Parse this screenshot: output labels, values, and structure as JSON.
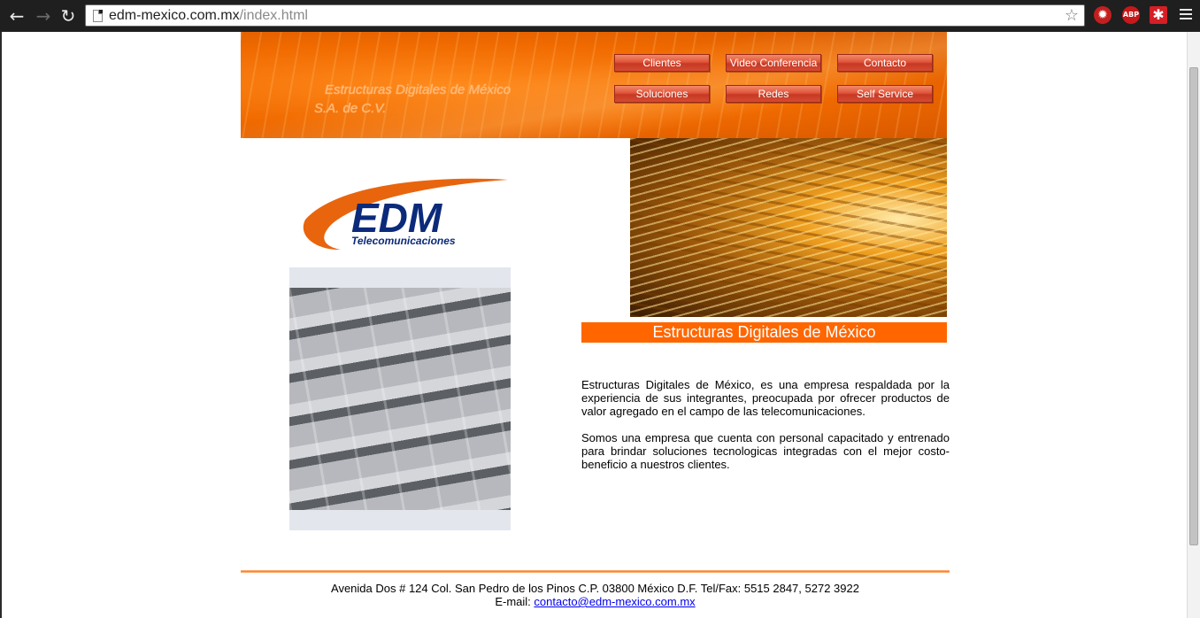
{
  "browser": {
    "url_host": "edm-mexico.com.mx",
    "url_path": "/index.html",
    "icons": [
      "back-icon",
      "forward-icon",
      "reload-icon",
      "page-icon",
      "star-icon",
      "extension-icon",
      "adblock-plus-icon",
      "lastpass-icon",
      "menu-icon"
    ],
    "extensions": {
      "abp_label": "ABP",
      "lastpass_label": "✱",
      "ext1_label": "✹"
    }
  },
  "header": {
    "company_line1": "Estructuras Digitales de México",
    "company_line2": "S.A. de C.V.",
    "nav": {
      "clientes": "Clientes",
      "video_conferencia": "Video Conferencia",
      "contacto": "Contacto",
      "soluciones": "Soluciones",
      "redes": "Redes",
      "self_service": "Self Service"
    },
    "accent_color": "#ff6600"
  },
  "logo": {
    "brand": "EDM",
    "tagline": "Telecomunicaciones",
    "brand_color": "#0b2a7a",
    "swoosh_color": "#e8650e"
  },
  "main": {
    "title": "Estructuras Digitales de México",
    "paragraph1": "Estructuras Digitales de México, es una empresa respaldada por la experiencia de sus integrantes, preocupada por ofrecer productos de valor agregado en el campo de las telecomunicaciones.",
    "paragraph2": "Somos una empresa que cuenta con personal capacitado y entrenado para brindar soluciones tecnologicas integradas  con el mejor costo-beneficio a nuestros clientes."
  },
  "footer": {
    "address": "Avenida Dos # 124 Col. San Pedro de los Pinos C.P. 03800 México D.F. Tel/Fax: 5515 2847, 5272 3922",
    "email_label": "E-mail: ",
    "email": "contacto@edm-mexico.com.mx"
  }
}
